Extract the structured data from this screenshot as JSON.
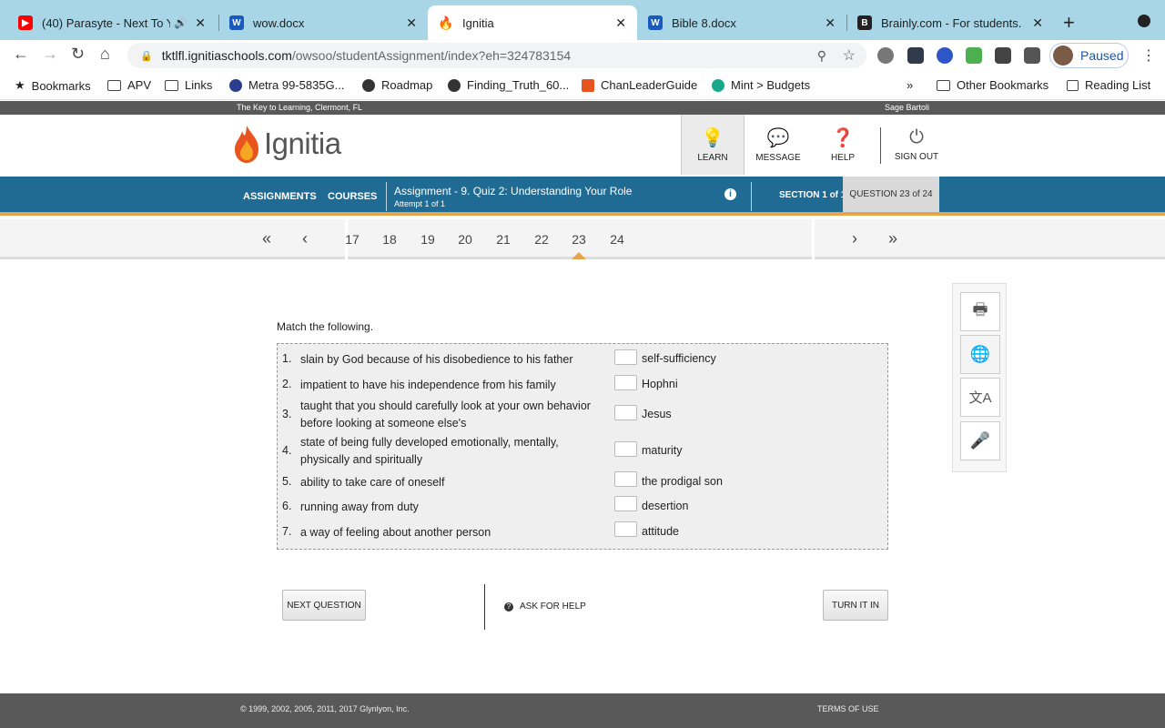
{
  "browser": {
    "tabs": [
      {
        "title": "(40) Parasyte - Next To Y",
        "icon": "youtube-icon",
        "color": "#ff0000"
      },
      {
        "title": "wow.docx",
        "icon": "word-icon",
        "color": "#185abd"
      },
      {
        "title": "Ignitia",
        "icon": "ignitia-flame-icon",
        "color": "#e8541e"
      },
      {
        "title": "Bible 8.docx",
        "icon": "word-icon",
        "color": "#185abd"
      },
      {
        "title": "Brainly.com - For students. B",
        "icon": "brainly-icon",
        "color": "#222222"
      }
    ],
    "address": {
      "host": "tktlfl.ignitiaschools.com",
      "path": "/owsoo/studentAssignment/index?eh=324783154"
    },
    "profile_status": "Paused",
    "bookmarks": [
      "Bookmarks",
      "APV",
      "Links",
      "Metra 99-5835G...",
      "Roadmap",
      "Finding_Truth_60...",
      "ChanLeaderGuide",
      "Mint > Budgets",
      "Other Bookmarks",
      "Reading List"
    ]
  },
  "site": {
    "tagline": "The Key to Learning, Clermont, FL",
    "user": "Sage Bartoli",
    "logo_text": "Ignitia",
    "header_buttons": [
      "LEARN",
      "MESSAGE",
      "HELP",
      "SIGN OUT"
    ],
    "nav": [
      "ASSIGNMENTS",
      "COURSES"
    ],
    "assignment_title": "Assignment  - 9. Quiz 2: Understanding Your Role",
    "attempt": "Attempt 1 of 1",
    "section": "SECTION 1 of 1",
    "question": "QUESTION 23 of 24",
    "question_numbers": [
      "17",
      "18",
      "19",
      "20",
      "21",
      "22",
      "23",
      "24"
    ],
    "current_question": "23",
    "accent_color": "#e7a44a",
    "bar_color": "#1f6b94"
  },
  "quiz": {
    "prompt": "Match the following.",
    "items": [
      {
        "num": "1.",
        "text": "slain by God because of his disobedience to his father",
        "answer": "self-sufficiency"
      },
      {
        "num": "2.",
        "text": "impatient to have his independence from his family",
        "answer": "Hophni"
      },
      {
        "num": "3.",
        "text": "taught that you should carefully look at your own behavior before looking at someone else's",
        "answer": "Jesus"
      },
      {
        "num": "4.",
        "text": "state of being fully developed emotionally, mentally, physically and spiritually",
        "answer": "maturity"
      },
      {
        "num": "5.",
        "text": "ability to take care of oneself",
        "answer": "the prodigal son"
      },
      {
        "num": "6.",
        "text": "running away from duty",
        "answer": "desertion"
      },
      {
        "num": "7.",
        "text": "a way of feeling about another person",
        "answer": "attitude"
      }
    ],
    "next_label": "NEXT QUESTION",
    "ask_help_label": "ASK FOR HELP",
    "turn_in_label": "TURN IT IN",
    "tools": [
      "print-icon",
      "globe-icon",
      "translate-icon",
      "microphone-icon"
    ]
  },
  "footer": {
    "copyright": "© 1999, 2002, 2005, 2011, 2017 Glynlyon, Inc.",
    "terms": "TERMS OF USE"
  }
}
